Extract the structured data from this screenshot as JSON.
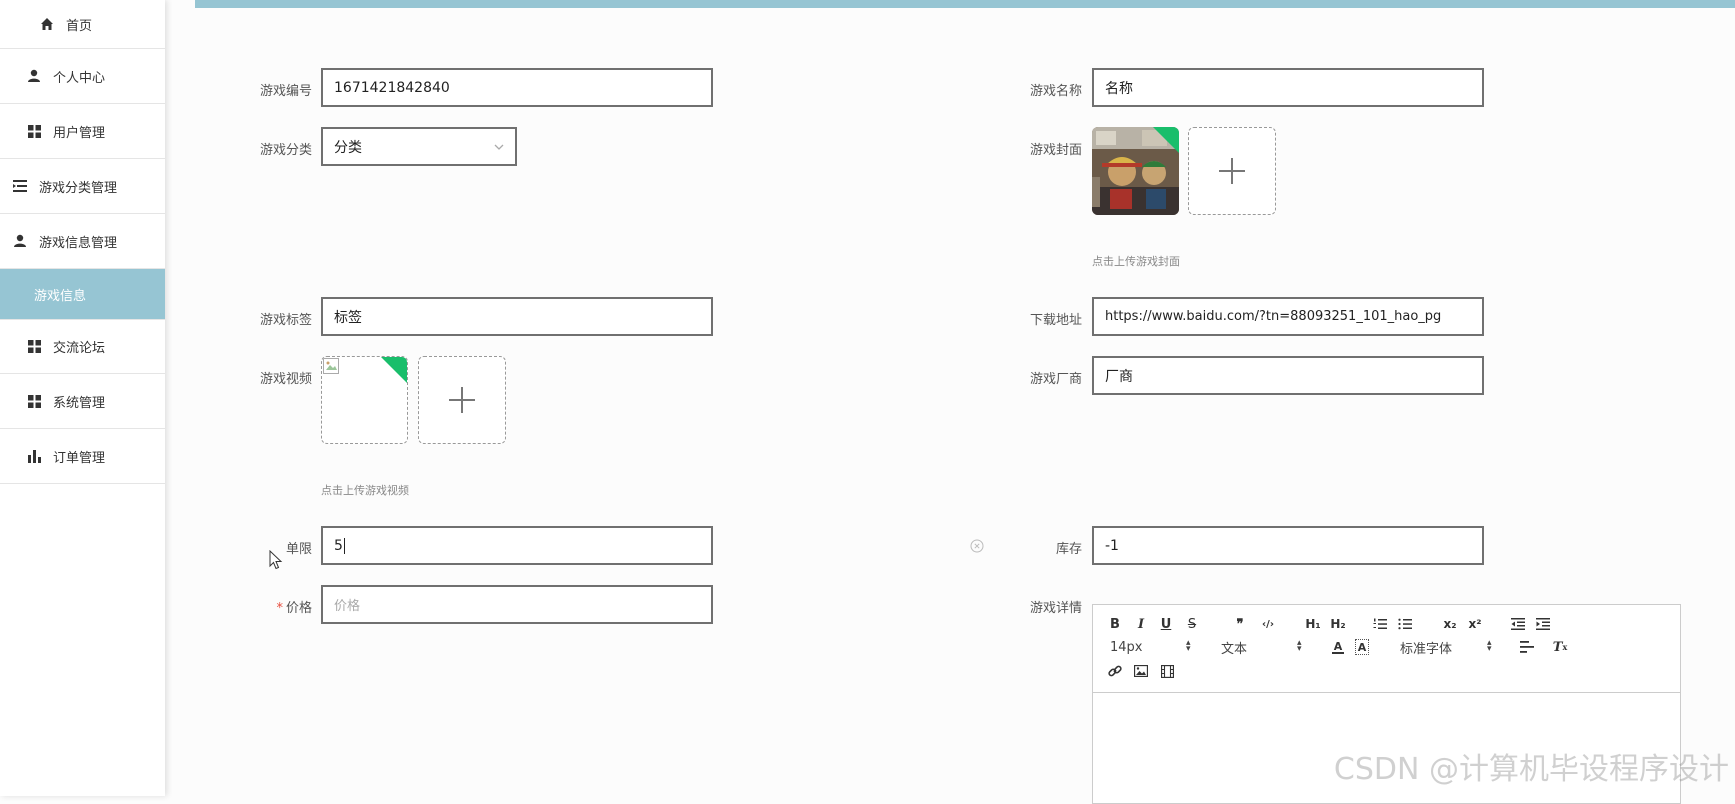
{
  "sidebar": {
    "items": [
      {
        "label": "首页",
        "icon": "home-icon"
      },
      {
        "label": "个人中心",
        "icon": "user-icon"
      },
      {
        "label": "用户管理",
        "icon": "grid-icon"
      },
      {
        "label": "游戏分类管理",
        "icon": "list-icon"
      },
      {
        "label": "游戏信息管理",
        "icon": "user-icon"
      },
      {
        "label": "游戏信息",
        "active": true
      },
      {
        "label": "交流论坛",
        "icon": "grid-icon"
      },
      {
        "label": "系统管理",
        "icon": "grid-icon"
      },
      {
        "label": "订单管理",
        "icon": "bar-chart-icon"
      }
    ]
  },
  "theme": {
    "accent": "#96c5d3",
    "required": "#e74c3c",
    "corner": "#19be6b"
  },
  "form": {
    "game_no": {
      "label": "游戏编号",
      "value": "1671421842840"
    },
    "game_name": {
      "label": "游戏名称",
      "value": "名称"
    },
    "category": {
      "label": "游戏分类",
      "value": "分类"
    },
    "cover": {
      "label": "游戏封面",
      "hint": "点击上传游戏封面"
    },
    "tags": {
      "label": "游戏标签",
      "value": "标签"
    },
    "download": {
      "label": "下载地址",
      "value": "https://www.baidu.com/?tn=88093251_101_hao_pg"
    },
    "video": {
      "label": "游戏视频",
      "hint": "点击上传游戏视频"
    },
    "vendor": {
      "label": "游戏厂商",
      "value": "厂商"
    },
    "limit": {
      "label": "单限",
      "value": "5"
    },
    "stock": {
      "label": "库存",
      "value": "-1"
    },
    "price": {
      "label": "价格",
      "required_mark": "*",
      "placeholder": "价格"
    },
    "detail": {
      "label": "游戏详情"
    }
  },
  "editor": {
    "font_size": "14px",
    "heading": "文本",
    "font_family": "标准字体"
  },
  "watermark": "CSDN @计算机毕设程序设计"
}
